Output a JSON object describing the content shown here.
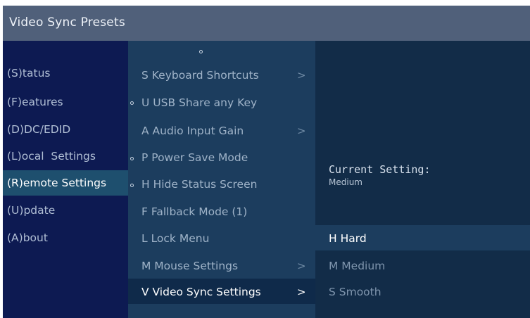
{
  "window": {
    "title": "Video Sync Presets"
  },
  "main_menu": {
    "items": [
      {
        "label": "(S)tatus"
      },
      {
        "label": "(F)eatures"
      },
      {
        "label": "(D)DC/EDID"
      },
      {
        "label": "(L)ocal  Settings"
      },
      {
        "label": "(R)emote Settings"
      },
      {
        "label": "(U)pdate"
      },
      {
        "label": "(A)bout"
      }
    ],
    "selected": "(R)emote Settings"
  },
  "remote_menu": {
    "items": [
      {
        "label": "S Keyboard Shortcuts",
        "submenu": true,
        "marker": false
      },
      {
        "label": "U USB Share any Key",
        "submenu": false,
        "marker": true
      },
      {
        "label": "A Audio Input Gain",
        "submenu": true,
        "marker": false
      },
      {
        "label": "P Power Save Mode",
        "submenu": false,
        "marker": true
      },
      {
        "label": "H Hide Status Screen",
        "submenu": false,
        "marker": true
      },
      {
        "label": "F Fallback Mode (1)",
        "submenu": false,
        "marker": false
      },
      {
        "label": "L Lock Menu",
        "submenu": false,
        "marker": false
      },
      {
        "label": "M Mouse Settings",
        "submenu": true,
        "marker": false
      },
      {
        "label": "V Video Sync Settings",
        "submenu": true,
        "marker": false
      }
    ],
    "selected": "V Video Sync Settings",
    "arrow_glyph": ">"
  },
  "video_sync_panel": {
    "current_setting_label": "Current Setting:",
    "current_setting_value": "Medium",
    "options": [
      {
        "label": "H Hard"
      },
      {
        "label": "M Medium"
      },
      {
        "label": "S Smooth"
      }
    ],
    "selected": "H Hard"
  },
  "colors": {
    "titlebar": "#50607a",
    "column1": "#0d1a52",
    "column2": "#1c3d5e",
    "column3": "#122c48",
    "selection1": "#1e4f6e",
    "selection2": "#0f2a4a",
    "selection3": "#1c3d5e"
  }
}
